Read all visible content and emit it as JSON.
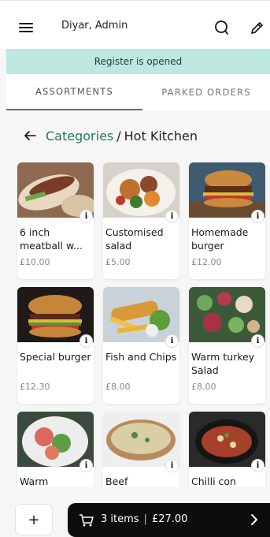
{
  "header": {
    "user": "Diyar, Admin"
  },
  "icons": {
    "menu": "hamburger-icon",
    "search": "search-icon",
    "edit": "pencil-icon",
    "back": "arrow-left-icon",
    "info": "info-icon",
    "cart": "cart-icon",
    "chevron": "chevron-right-icon"
  },
  "banner": {
    "text": "Register is opened"
  },
  "tabs": [
    {
      "label": "ASSORTMENTS",
      "active": true
    },
    {
      "label": "PARKED ORDERS",
      "active": false
    }
  ],
  "breadcrumb": {
    "parent": "Categories",
    "separator": "/",
    "current": "Hot Kitchen"
  },
  "products": [
    {
      "name": "6 inch meatball w...",
      "price": "£10.00"
    },
    {
      "name": "Customised salad",
      "price": "£5.00"
    },
    {
      "name": "Homemade burger",
      "price": "£12.00"
    },
    {
      "name": "Special burger",
      "price": "£12.30"
    },
    {
      "name": "Fish and Chips",
      "price": "£8.00"
    },
    {
      "name": "Warm turkey Salad",
      "price": "£8.00"
    },
    {
      "name": "Warm",
      "price": ""
    },
    {
      "name": "Beef",
      "price": ""
    },
    {
      "name": "Chilli con",
      "price": ""
    }
  ],
  "info_glyph": "i",
  "footer": {
    "add_label": "+",
    "items_label": "3 items",
    "separator": "|",
    "total": "£27.00"
  },
  "colors": {
    "accent": "#1d7a5b",
    "banner": "#bde8e2",
    "cart": "#0d0d0d"
  }
}
